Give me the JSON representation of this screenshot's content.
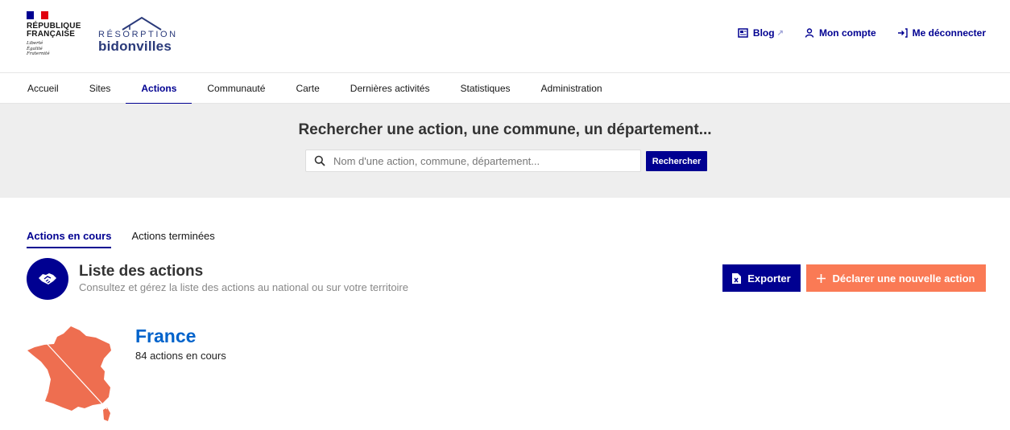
{
  "header": {
    "gov_logo": {
      "line1": "RÉPUBLIQUE",
      "line2": "FRANÇAISE",
      "motto": [
        "Liberté",
        "Égalité",
        "Fraternité"
      ]
    },
    "app_logo": {
      "line1": "RÉSORPTION",
      "line2": "bidonvilles"
    },
    "links": [
      {
        "label": "Blog",
        "icon": "newspaper-icon"
      },
      {
        "label": "Mon compte",
        "icon": "user-icon"
      },
      {
        "label": "Me déconnecter",
        "icon": "logout-icon"
      }
    ]
  },
  "nav": {
    "items": [
      {
        "label": "Accueil"
      },
      {
        "label": "Sites"
      },
      {
        "label": "Actions",
        "active": true
      },
      {
        "label": "Communauté"
      },
      {
        "label": "Carte"
      },
      {
        "label": "Dernières activités"
      },
      {
        "label": "Statistiques"
      },
      {
        "label": "Administration"
      }
    ]
  },
  "search": {
    "title": "Rechercher une action, une commune, un département...",
    "placeholder": "Nom d'une action, commune, département...",
    "value": "",
    "button_label": "Rechercher"
  },
  "tabs": [
    {
      "label": "Actions en cours",
      "active": true
    },
    {
      "label": "Actions terminées"
    }
  ],
  "section": {
    "title": "Liste des actions",
    "subtitle": "Consultez et gérez la liste des actions au national ou sur votre territoire",
    "export_label": "Exporter",
    "declare_label": "Déclarer une nouvelle action"
  },
  "region": {
    "name": "France",
    "count_text": "84 actions en cours"
  },
  "colors": {
    "primary": "#000091",
    "accent": "#fa7a55",
    "link": "#0063cb",
    "search_band": "#eeeeee"
  }
}
